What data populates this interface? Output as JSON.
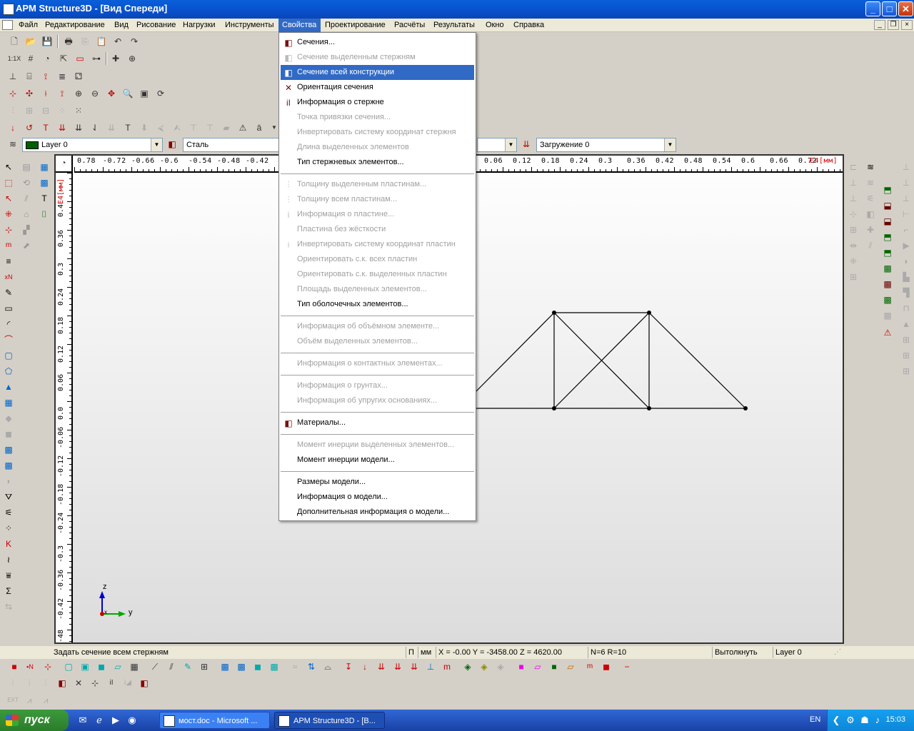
{
  "window": {
    "title": "APM Structure3D - [Вид Спереди]",
    "min": "_",
    "max": "□",
    "close": "✕"
  },
  "menubar": {
    "items": [
      "Файл",
      "Редактирование",
      "Вид",
      "Рисование",
      "Нагрузки",
      "Инструменты",
      "Свойства",
      "Проектирование",
      "Расчёты",
      "Результаты",
      "Окно",
      "Справка"
    ],
    "active": "Свойства"
  },
  "combos": {
    "layer": "Layer 0",
    "material": "Сталь",
    "loading": "Загружение 0"
  },
  "ruler": {
    "h_ticks": [
      "0.78",
      "-0.72",
      "-0.66",
      "-0.6",
      "-0.54",
      "-0.48",
      "-0.42",
      "0.06",
      "0.12",
      "0.18",
      "0.24",
      "0.3",
      "0.36",
      "0.42",
      "0.48",
      "0.54",
      "0.6",
      "0.66",
      "0.72"
    ],
    "h_unit": "E4[мм]",
    "v_ticks": [
      "0.4",
      "0.36",
      "0.3",
      "0.24",
      "0.18",
      "0.12",
      "0.06",
      "0.0",
      "-0.06",
      "-0.12",
      "-0.18",
      "-0.24",
      "-0.3",
      "-0.36",
      "-0.42",
      "-48"
    ],
    "v_unit": "E4[мм]"
  },
  "dropdown": {
    "items": [
      {
        "label": "Сечения...",
        "disabled": false,
        "icon": "section-icon"
      },
      {
        "label": "Сечение выделенным стержням",
        "disabled": true,
        "icon": "section-selected-icon"
      },
      {
        "label": "Сечение всей конструкции",
        "disabled": false,
        "highlight": true,
        "icon": "section-all-icon"
      },
      {
        "label": "Ориентация сечения",
        "disabled": false,
        "icon": "orientation-icon"
      },
      {
        "label": "Информация о стержне",
        "disabled": false,
        "icon": "rod-info-icon"
      },
      {
        "label": "Точка привязки сечения...",
        "disabled": true
      },
      {
        "label": "Инвертировать систему координат стержня",
        "disabled": true
      },
      {
        "label": "Длина выделенных элементов",
        "disabled": true
      },
      {
        "label": "Тип стержневых элементов...",
        "disabled": false
      },
      {
        "sep": true
      },
      {
        "label": "Толщину выделенным пластинам...",
        "disabled": true,
        "icon": "plate-thickness-icon"
      },
      {
        "label": "Толщину всем пластинам...",
        "disabled": true,
        "icon": "plate-thickness-all-icon"
      },
      {
        "label": "Информация о пластине...",
        "disabled": true,
        "icon": "plate-info-icon"
      },
      {
        "label": "Пластина без жёсткости",
        "disabled": true
      },
      {
        "label": "Инвертировать систему координат пластин",
        "disabled": true,
        "icon": "invert-plate-icon"
      },
      {
        "label": "Ориентировать с.к. всех пластин",
        "disabled": true
      },
      {
        "label": "Ориентировать с.к. выделенных пластин",
        "disabled": true
      },
      {
        "label": "Площадь выделенных элементов...",
        "disabled": true
      },
      {
        "label": "Тип оболочечных элементов...",
        "disabled": false
      },
      {
        "sep": true
      },
      {
        "label": "Информация об объёмном элементе...",
        "disabled": true
      },
      {
        "label": "Объём выделенных элементов...",
        "disabled": true
      },
      {
        "sep": true
      },
      {
        "label": "Информация о контактных элементах...",
        "disabled": true
      },
      {
        "sep": true
      },
      {
        "label": "Информация о грунтах...",
        "disabled": true
      },
      {
        "label": "Информация об упругих основаниях...",
        "disabled": true
      },
      {
        "sep": true
      },
      {
        "label": "Материалы...",
        "disabled": false,
        "icon": "materials-icon"
      },
      {
        "sep": true
      },
      {
        "label": "Момент инерции выделенных элементов...",
        "disabled": true
      },
      {
        "label": "Момент инерции модели...",
        "disabled": false
      },
      {
        "sep": true
      },
      {
        "label": "Размеры модели...",
        "disabled": false
      },
      {
        "label": "Информация о модели...",
        "disabled": false
      },
      {
        "label": "Дополнительная информация о модели...",
        "disabled": false
      }
    ]
  },
  "axes": {
    "z": "z",
    "y": "y",
    "x": "x"
  },
  "status": {
    "hint": "Задать сечение всем стержням",
    "proj": "П",
    "unit": "мм",
    "coords": "X = -0.00 Y = -3458.00 Z = 4620.00",
    "nr": "N=6 R=10",
    "mode": "Вытолкнуть",
    "layer": "Layer 0"
  },
  "toolbar_text": {
    "zoom11": "1:1X"
  },
  "taskbar": {
    "start": "пуск",
    "tasks": [
      {
        "label": "мост.doc - Microsoft ...",
        "active": false
      },
      {
        "label": "APM Structure3D - [В...",
        "active": true
      }
    ],
    "lang": "EN",
    "clock": "15:03"
  }
}
